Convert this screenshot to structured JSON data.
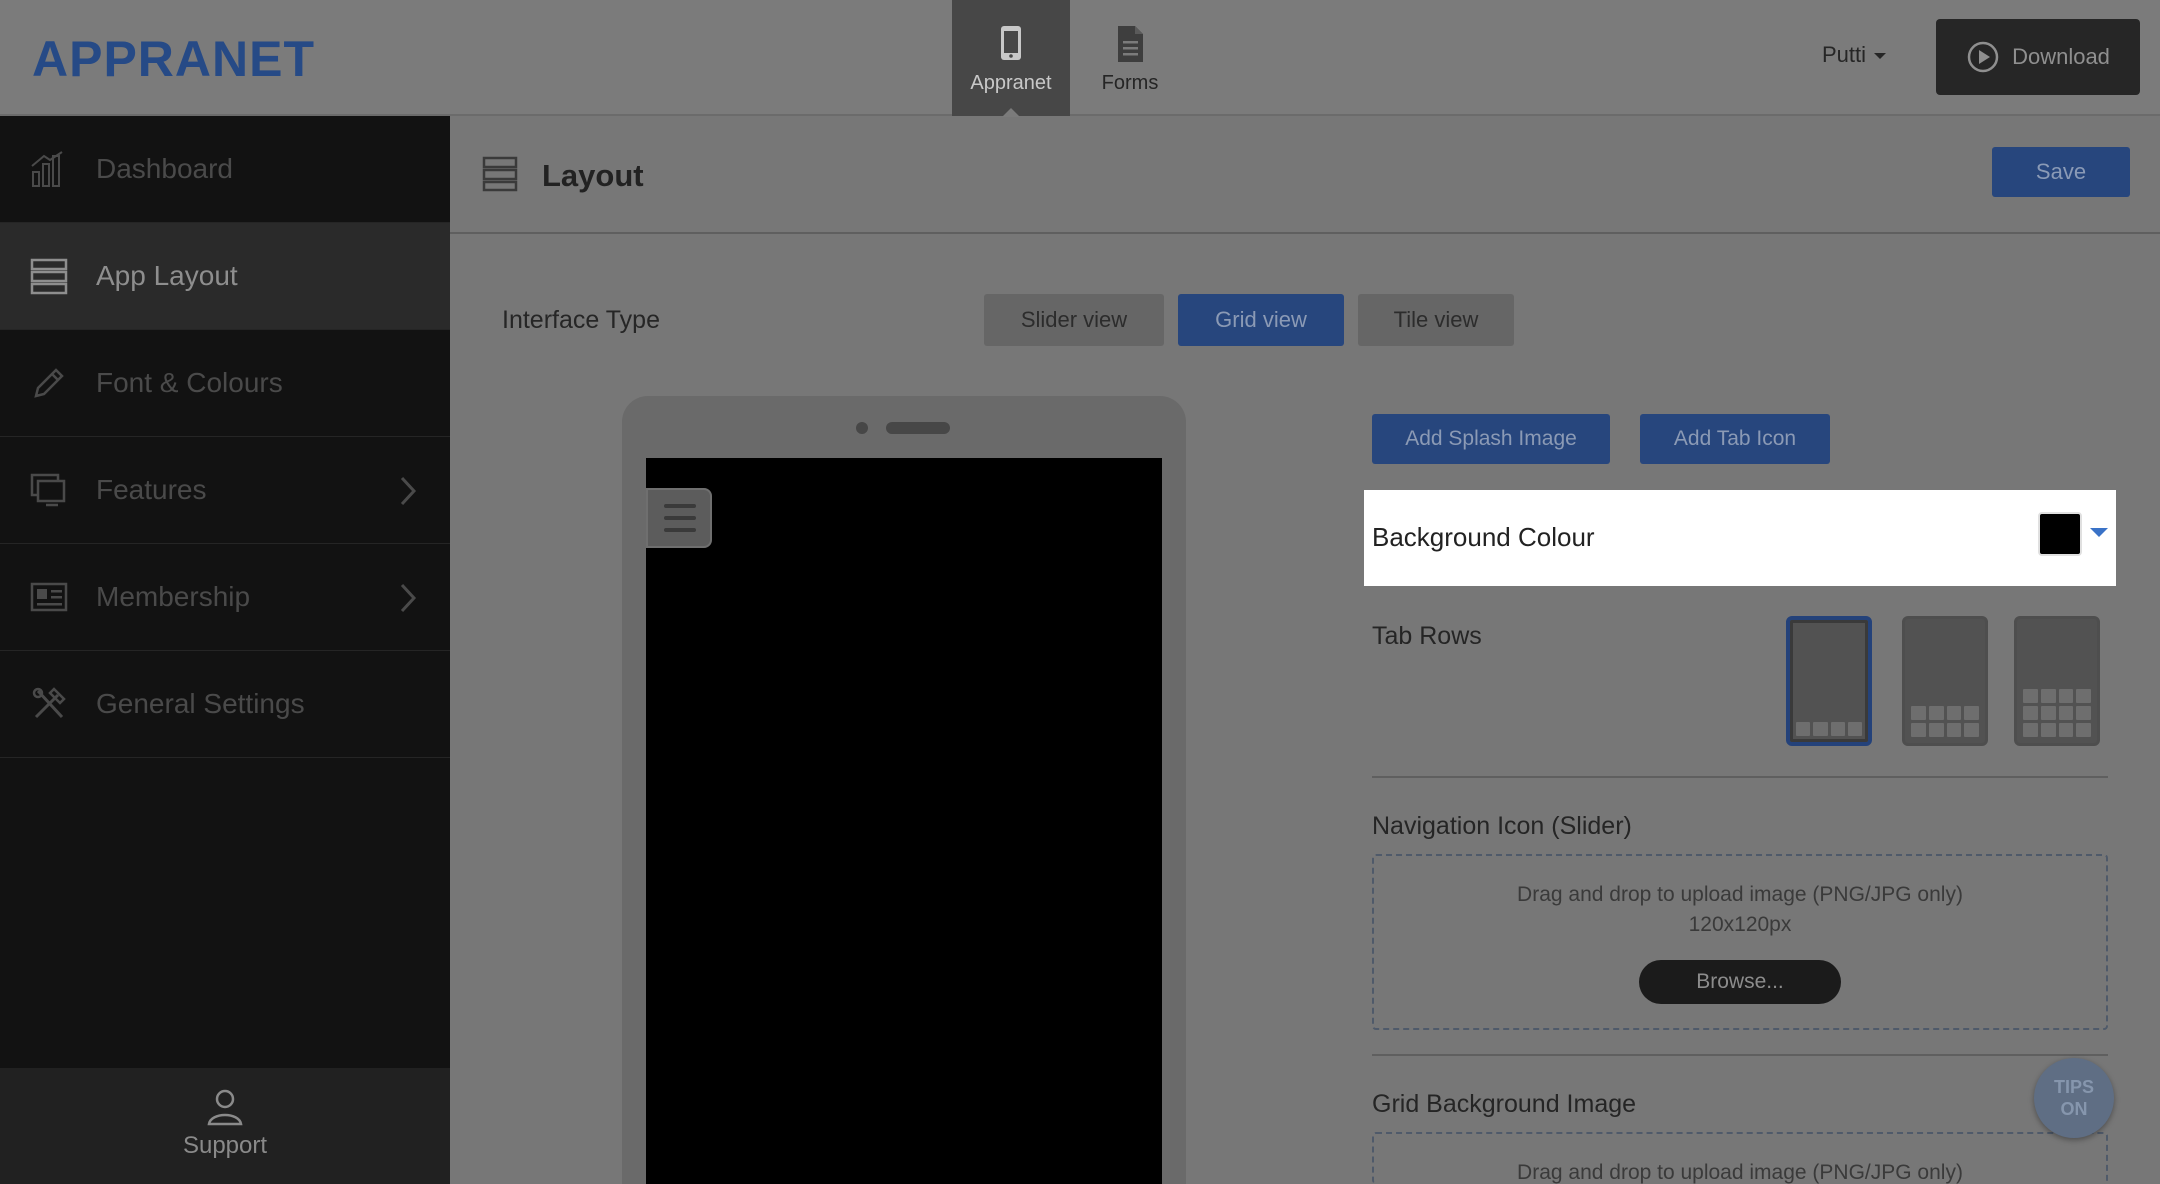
{
  "app": {
    "logo_text": "APPRANET"
  },
  "topnav": {
    "items": [
      {
        "label": "Appranet",
        "icon": "phone-icon",
        "active": true
      },
      {
        "label": "Forms",
        "icon": "document-icon",
        "active": false
      }
    ]
  },
  "user": {
    "name": "Putti"
  },
  "download": {
    "label": "Download",
    "icon": "play-circle-icon"
  },
  "sidebar": {
    "items": [
      {
        "label": "Dashboard",
        "icon": "bar-chart-icon"
      },
      {
        "label": "App Layout",
        "icon": "layout-rows-icon",
        "active": true
      },
      {
        "label": "Font & Colours",
        "icon": "pencil-icon"
      },
      {
        "label": "Features",
        "icon": "monitor-icon",
        "has_submenu": true
      },
      {
        "label": "Membership",
        "icon": "id-card-icon",
        "has_submenu": true
      },
      {
        "label": "General Settings",
        "icon": "tools-icon"
      }
    ],
    "support_label": "Support"
  },
  "page": {
    "title": "Layout",
    "save_label": "Save"
  },
  "interface": {
    "label": "Interface Type",
    "options": [
      "Slider view",
      "Grid view",
      "Tile view"
    ],
    "selected": "Grid view"
  },
  "buttons": {
    "add_splash": "Add Splash Image",
    "add_tab_icon": "Add Tab Icon"
  },
  "background_colour": {
    "label": "Background Colour",
    "value": "#000000"
  },
  "tab_rows": {
    "label": "Tab Rows",
    "options": [
      1,
      2,
      3
    ],
    "selected": 1
  },
  "navigation_icon": {
    "label": "Navigation Icon (Slider)",
    "hint": "Drag and drop to upload image (PNG/JPG only)",
    "size": "120x120px",
    "browse_label": "Browse..."
  },
  "grid_background": {
    "label": "Grid Background Image",
    "hint": "Drag and drop to upload image (PNG/JPG only)"
  },
  "tips": {
    "line1": "TIPS",
    "line2": "ON"
  },
  "colors": {
    "accent_blue": "#27467d",
    "logo_blue": "#264a86",
    "sidebar_bg": "#121212",
    "overlay_bg": "#777777"
  }
}
